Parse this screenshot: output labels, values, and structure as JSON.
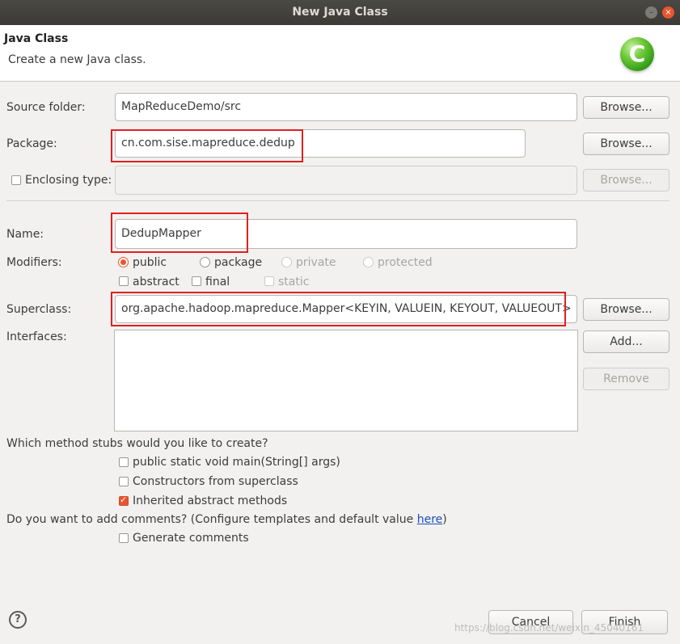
{
  "window": {
    "title": "New Java Class"
  },
  "header": {
    "title": "Java Class",
    "description": "Create a new Java class.",
    "icon": "java-class-icon",
    "icon_glyph": "C"
  },
  "source_folder": {
    "label": "Source folder:",
    "value": "MapReduceDemo/src",
    "browse_label": "Browse..."
  },
  "package": {
    "label": "Package:",
    "value": "cn.com.sise.mapreduce.dedup",
    "browse_label": "Browse..."
  },
  "enclosing_type": {
    "label": "Enclosing type:",
    "value": "",
    "browse_label": "Browse...",
    "checked": false
  },
  "name": {
    "label": "Name:",
    "value": "DedupMapper"
  },
  "modifiers": {
    "label": "Modifiers:",
    "access": [
      {
        "label": "public",
        "selected": true,
        "enabled": true
      },
      {
        "label": "package",
        "selected": false,
        "enabled": true
      },
      {
        "label": "private",
        "selected": false,
        "enabled": false
      },
      {
        "label": "protected",
        "selected": false,
        "enabled": false
      }
    ],
    "flags": [
      {
        "label": "abstract",
        "checked": false,
        "enabled": true
      },
      {
        "label": "final",
        "checked": false,
        "enabled": true
      },
      {
        "label": "static",
        "checked": false,
        "enabled": false
      }
    ]
  },
  "superclass": {
    "label": "Superclass:",
    "value": "org.apache.hadoop.mapreduce.Mapper<KEYIN, VALUEIN, KEYOUT, VALUEOUT>",
    "browse_label": "Browse..."
  },
  "interfaces": {
    "label": "Interfaces:",
    "add_label": "Add...",
    "remove_label": "Remove",
    "items": []
  },
  "stubs": {
    "question": "Which method stubs would you like to create?",
    "options": [
      {
        "label": "public static void main(String[] args)",
        "checked": false
      },
      {
        "label": "Constructors from superclass",
        "checked": false
      },
      {
        "label": "Inherited abstract methods",
        "checked": true
      }
    ]
  },
  "comments": {
    "question_prefix": "Do you want to add comments? (Configure templates and default value ",
    "link": "here",
    "question_suffix": ")",
    "option": {
      "label": "Generate comments",
      "checked": false
    }
  },
  "footer": {
    "cancel_label": "Cancel",
    "finish_label": "Finish",
    "help_glyph": "?"
  },
  "watermark": "https://blog.csdn.net/weixin_45040161"
}
